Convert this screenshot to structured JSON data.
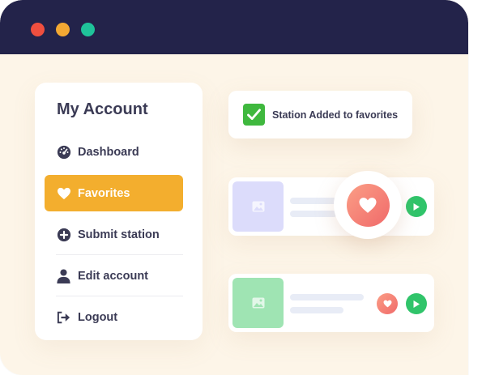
{
  "window": {
    "controls": [
      {
        "name": "close",
        "color": "#ef4f3f"
      },
      {
        "name": "minimize",
        "color": "#f3a833"
      },
      {
        "name": "maximize",
        "color": "#1fc39a"
      }
    ]
  },
  "sidebar": {
    "title": "My Account",
    "items": [
      {
        "label": "Dashboard",
        "icon": "gauge-icon",
        "active": false
      },
      {
        "label": "Favorites",
        "icon": "heart-icon",
        "active": true
      },
      {
        "label": "Submit station",
        "icon": "plus-circle-icon",
        "active": false
      },
      {
        "label": "Edit account",
        "icon": "user-icon",
        "active": false
      },
      {
        "label": "Logout",
        "icon": "logout-icon",
        "active": false
      }
    ]
  },
  "toast": {
    "text": "Station Added to favorites",
    "icon": "check-icon"
  },
  "stations": [
    {
      "thumb_color": "#dcdcfb",
      "favorited": true
    },
    {
      "thumb_color": "#9fe4b3",
      "favorited": true
    }
  ],
  "colors": {
    "accent": "#f3ae2e",
    "play": "#30c46a",
    "heart": "#f06a6a",
    "titlebar": "#23234a"
  }
}
